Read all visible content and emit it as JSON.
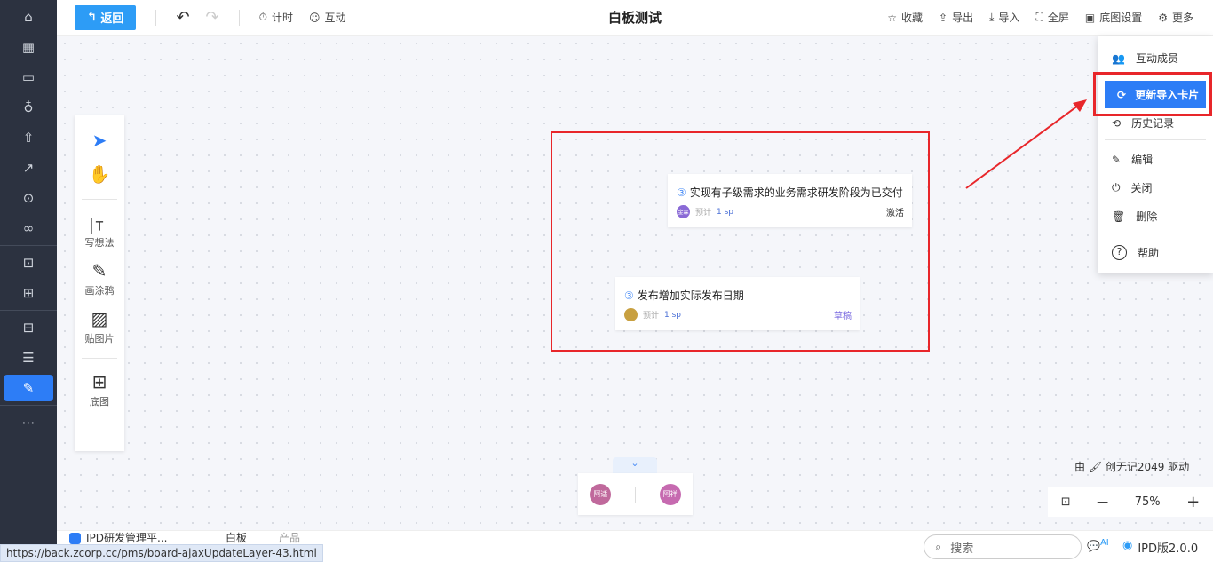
{
  "header": {
    "back": "返回",
    "timer": "计时",
    "interact": "互动",
    "title": "白板测试",
    "favorite": "收藏",
    "export": "导出",
    "import": "导入",
    "fullscreen": "全屏",
    "bg_settings": "底图设置",
    "more": "更多"
  },
  "tools": {
    "write": "写想法",
    "draw": "画涂鸦",
    "image": "贴图片",
    "background": "底图"
  },
  "cards": [
    {
      "num": "③",
      "title": "实现有子级需求的业务需求研发阶段为已交付",
      "est_label": "预计",
      "est": "1 sp",
      "status": "激活",
      "avatar": "金森"
    },
    {
      "num": "③",
      "title": "发布增加实际发布日期",
      "est_label": "预计",
      "est": "1 sp",
      "status": "草稿",
      "avatar": ""
    }
  ],
  "menu": {
    "members": "互动成员",
    "update": "更新导入卡片",
    "history": "历史记录",
    "edit": "编辑",
    "close": "关闭",
    "delete": "删除",
    "help": "帮助"
  },
  "users": [
    "阿适",
    "阿祥"
  ],
  "powered": "由 🖌 创无记2049 驱动",
  "zoom": "75%",
  "bottom": {
    "app": "IPD研发管理平...",
    "tab1": "白板",
    "tab2": "产品",
    "search": "搜索",
    "ai": "AI",
    "version": "IPD版2.0.0"
  },
  "status_url": "https://back.zcorp.cc/pms/board-ajaxUpdateLayer-43.html",
  "colors": {
    "accent": "#2d7df6",
    "highlight": "#e8262a"
  }
}
